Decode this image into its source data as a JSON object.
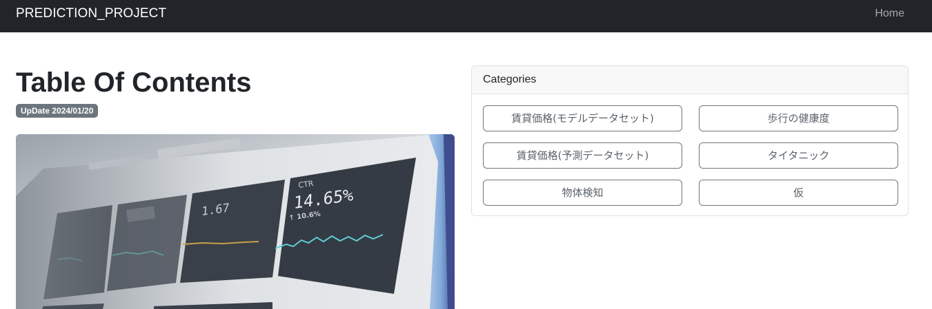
{
  "navbar": {
    "brand": "PREDICTION_PROJECT",
    "home_label": "Home",
    "bg_color": "#212529"
  },
  "main": {
    "title": "Table Of Contents",
    "update_badge": "UpDate 2024/01/20",
    "hero_image": {
      "description_icon": "dashboard-photo",
      "ctr_label": "CTR",
      "ctr_value": "14.65%",
      "ctr_delta": "↑ 10.6%",
      "other_value": "1.67"
    }
  },
  "categories": {
    "header": "Categories",
    "items": [
      {
        "label": "賃貸価格(モデルデータセット)"
      },
      {
        "label": "歩行の健康度"
      },
      {
        "label": "賃貸価格(予測データセット)"
      },
      {
        "label": "タイタニック"
      },
      {
        "label": "物体検知"
      },
      {
        "label": "仮"
      }
    ]
  }
}
